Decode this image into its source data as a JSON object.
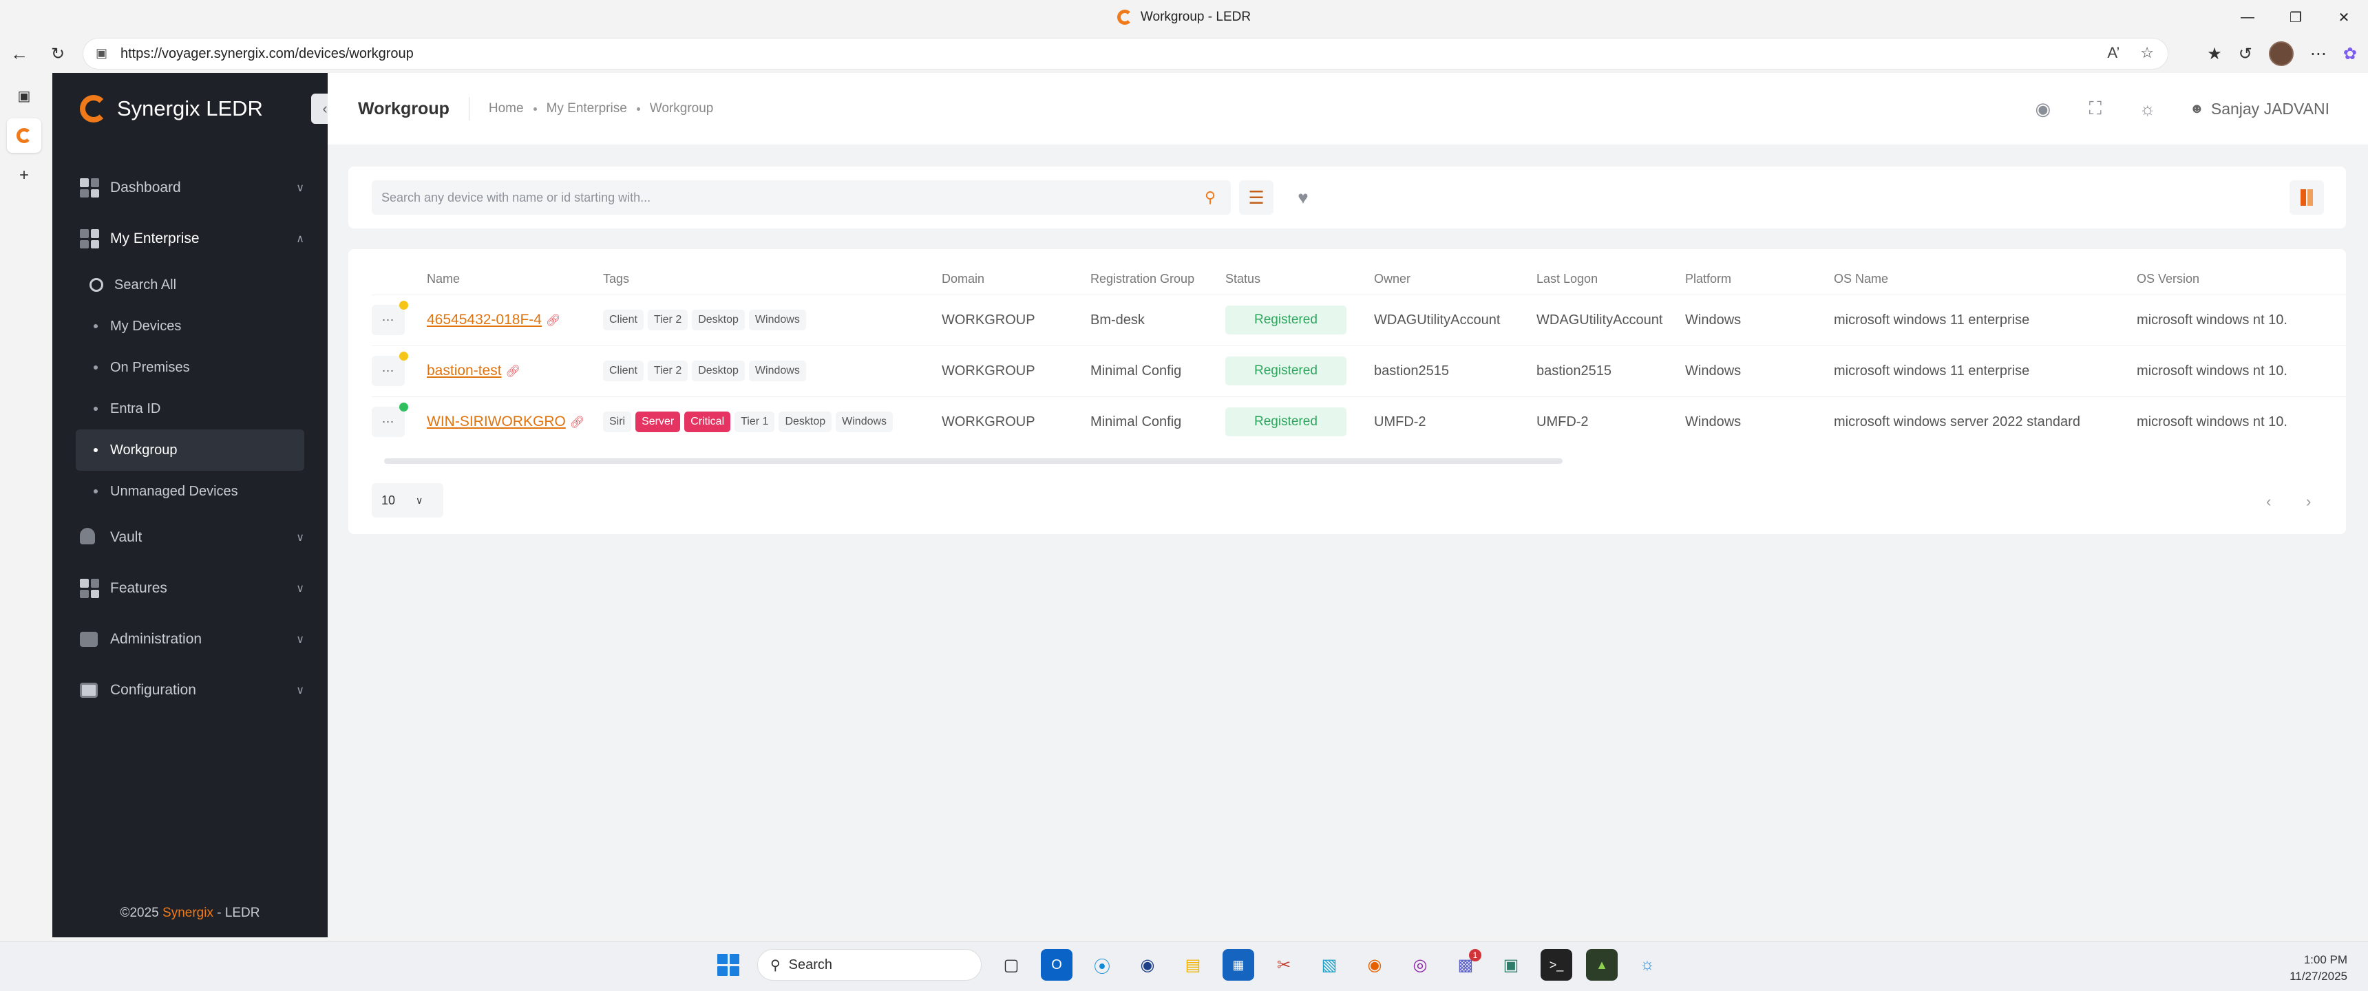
{
  "window": {
    "title": "Workgroup - LEDR"
  },
  "browser": {
    "url": "https://voyager.synergix.com/devices/workgroup"
  },
  "sidebar": {
    "brand": "Synergix LEDR",
    "menu": [
      {
        "label": "Dashboard",
        "icon": "dashboard-icon"
      },
      {
        "label": "My Enterprise",
        "icon": "enterprise-icon",
        "open": true,
        "children": [
          {
            "label": "Search All",
            "icon": "search-circle-icon"
          },
          {
            "label": "My Devices"
          },
          {
            "label": "On Premises"
          },
          {
            "label": "Entra ID"
          },
          {
            "label": "Workgroup",
            "active": true
          },
          {
            "label": "Unmanaged Devices"
          }
        ]
      },
      {
        "label": "Vault",
        "icon": "vault-icon"
      },
      {
        "label": "Features",
        "icon": "features-icon"
      },
      {
        "label": "Administration",
        "icon": "administration-icon"
      },
      {
        "label": "Configuration",
        "icon": "configuration-icon"
      }
    ],
    "footer_prefix": "©2025 ",
    "footer_brand": "Synergix",
    "footer_suffix": " - LEDR"
  },
  "header": {
    "title": "Workgroup",
    "breadcrumb": [
      "Home",
      "My Enterprise",
      "Workgroup"
    ],
    "user": "Sanjay JADVANI"
  },
  "search": {
    "placeholder": "Search any device with name or id starting with..."
  },
  "table": {
    "columns": [
      "Name",
      "Tags",
      "Domain",
      "Registration Group",
      "Status",
      "Owner",
      "Last Logon",
      "Platform",
      "OS Name",
      "OS Version"
    ],
    "rows": [
      {
        "status_color": "#f5c518",
        "name": "46545432-018F-4",
        "tags": [
          {
            "label": "Client"
          },
          {
            "label": "Tier 2"
          },
          {
            "label": "Desktop"
          },
          {
            "label": "Windows"
          }
        ],
        "domain": "WORKGROUP",
        "group": "Bm-desk",
        "status": "Registered",
        "owner": "WDAGUtilityAccount",
        "last_logon": "WDAGUtilityAccount",
        "platform": "Windows",
        "os_name": "microsoft windows 11 enterprise",
        "os_version": "microsoft windows nt 10."
      },
      {
        "status_color": "#f5c518",
        "name": "bastion-test",
        "tags": [
          {
            "label": "Client"
          },
          {
            "label": "Tier 2"
          },
          {
            "label": "Desktop"
          },
          {
            "label": "Windows"
          }
        ],
        "domain": "WORKGROUP",
        "group": "Minimal Config",
        "status": "Registered",
        "owner": "bastion2515",
        "last_logon": "bastion2515",
        "platform": "Windows",
        "os_name": "microsoft windows 11 enterprise",
        "os_version": "microsoft windows nt 10."
      },
      {
        "status_color": "#2fbf5c",
        "name": "WIN-SIRIWORKGRO",
        "tags": [
          {
            "label": "Siri"
          },
          {
            "label": "Server",
            "red": true
          },
          {
            "label": "Critical",
            "red": true
          },
          {
            "label": "Tier 1"
          },
          {
            "label": "Desktop"
          },
          {
            "label": "Windows"
          }
        ],
        "domain": "WORKGROUP",
        "group": "Minimal Config",
        "status": "Registered",
        "owner": "UMFD-2",
        "last_logon": "UMFD-2",
        "platform": "Windows",
        "os_name": "microsoft windows server 2022 standard",
        "os_version": "microsoft windows nt 10."
      }
    ],
    "page_size": "10"
  },
  "taskbar": {
    "search_label": "Search",
    "time": "1:00 PM",
    "date": "11/27/2025",
    "teams_badge": "1"
  }
}
